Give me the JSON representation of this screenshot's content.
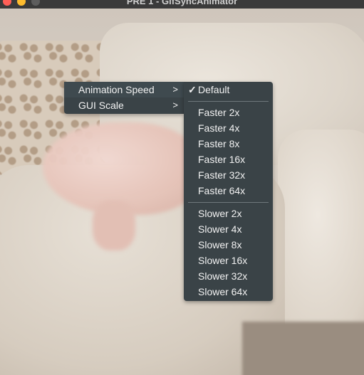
{
  "window": {
    "title": "PRE 1 - GifSyncAnimator"
  },
  "context_menu": {
    "items": [
      {
        "label": "Animation Speed",
        "arrow": ">"
      },
      {
        "label": "GUI Scale",
        "arrow": ">"
      }
    ]
  },
  "speed_submenu": {
    "checkmark": "✓",
    "default_label": "Default",
    "faster": [
      "Faster 2x",
      "Faster 4x",
      "Faster 8x",
      "Faster 16x",
      "Faster 32x",
      "Faster 64x"
    ],
    "slower": [
      "Slower 2x",
      "Slower 4x",
      "Slower 8x",
      "Slower 16x",
      "Slower 32x",
      "Slower 64x"
    ]
  },
  "colors": {
    "menu_bg": "#3a4347",
    "menu_text": "#f2f2f2",
    "separator": "#6f787c"
  }
}
